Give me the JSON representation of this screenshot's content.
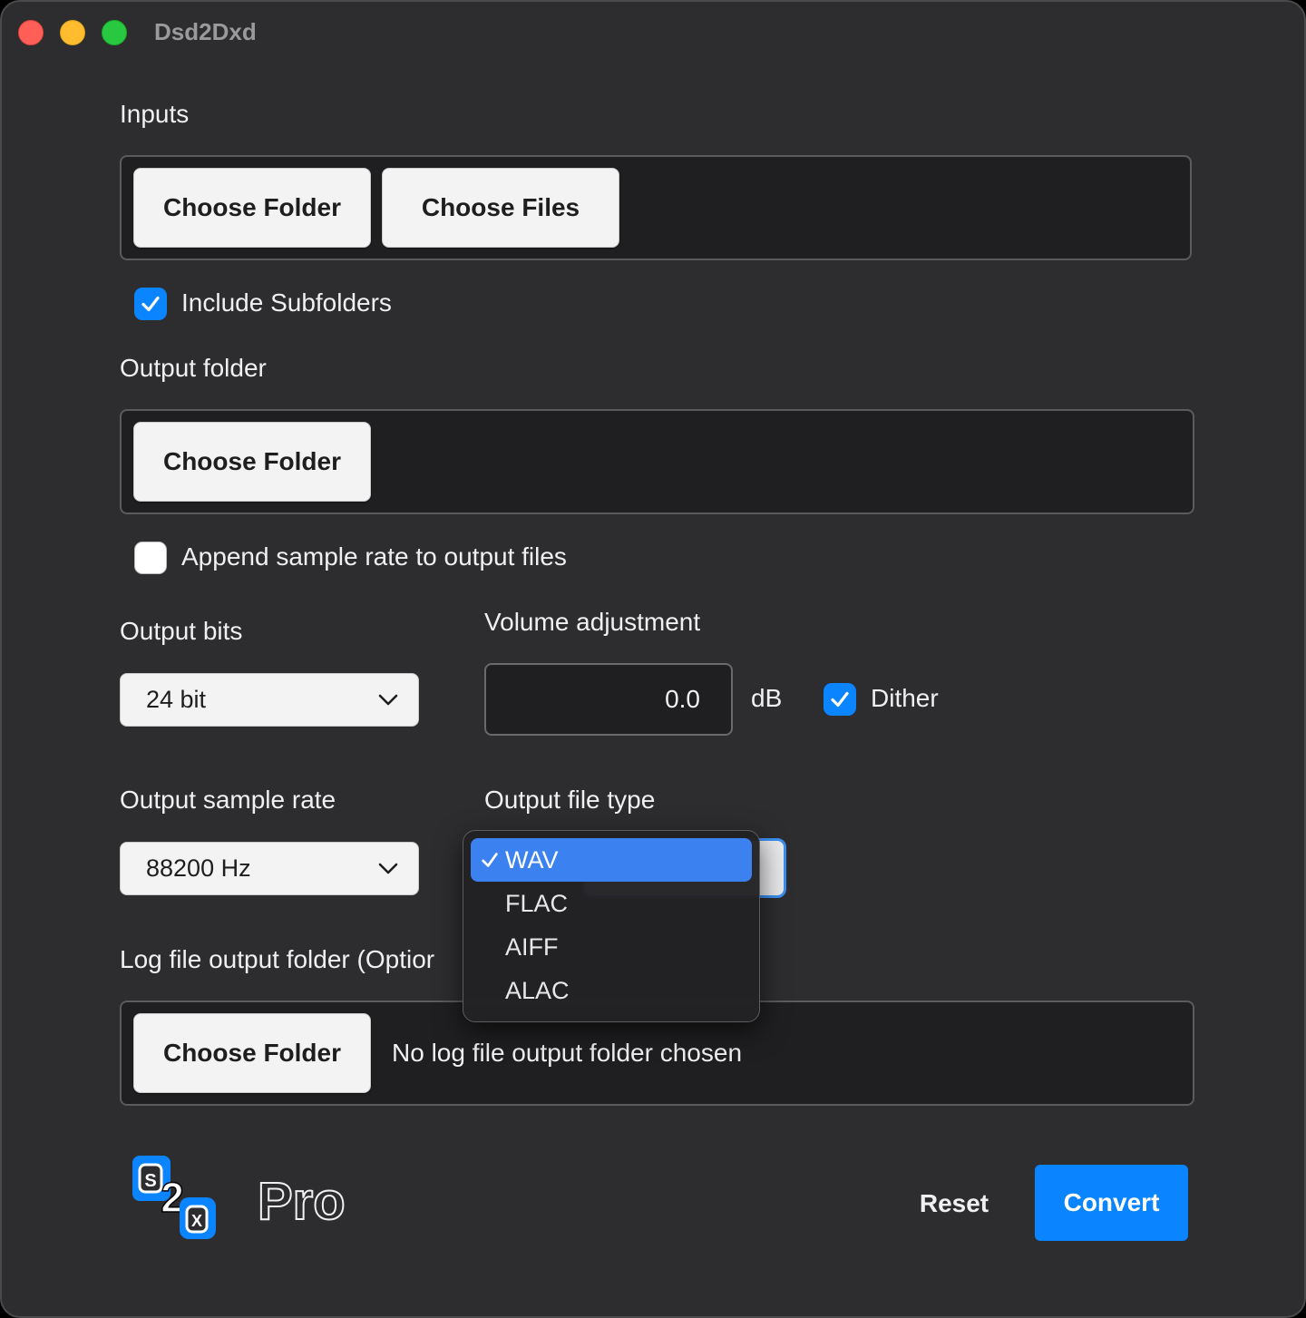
{
  "window": {
    "title": "Dsd2Dxd"
  },
  "inputs": {
    "heading": "Inputs",
    "choose_folder": "Choose Folder",
    "choose_files": "Choose Files",
    "include_subfolders": {
      "label": "Include Subfolders",
      "checked": true
    }
  },
  "output_folder": {
    "heading": "Output folder",
    "choose_folder": "Choose Folder",
    "append_sample_rate": {
      "label": "Append sample rate to output files",
      "checked": false
    }
  },
  "output_bits": {
    "heading": "Output bits",
    "value": "24 bit"
  },
  "volume": {
    "heading": "Volume adjustment",
    "value": "0.0",
    "unit": "dB",
    "dither": {
      "label": "Dither",
      "checked": true
    }
  },
  "sample_rate": {
    "heading": "Output sample rate",
    "value": "88200 Hz"
  },
  "file_type": {
    "heading": "Output file type",
    "selected": "WAV",
    "options": [
      "WAV",
      "FLAC",
      "AIFF",
      "ALAC"
    ]
  },
  "log_folder": {
    "heading": "Log file output folder (Optior",
    "choose_folder": "Choose Folder",
    "status": "No log file output folder chosen"
  },
  "footer": {
    "logo_text": "Pro",
    "reset": "Reset",
    "convert": "Convert"
  },
  "colors": {
    "accent": "#0a84ff",
    "window_bg": "#2d2d2f",
    "panel_bg": "#1f1f21",
    "selection": "#3b82f0"
  },
  "icons": {
    "check": "check-icon",
    "chevron": "chevron-down-icon",
    "logo": "d2d-logo-icon"
  }
}
